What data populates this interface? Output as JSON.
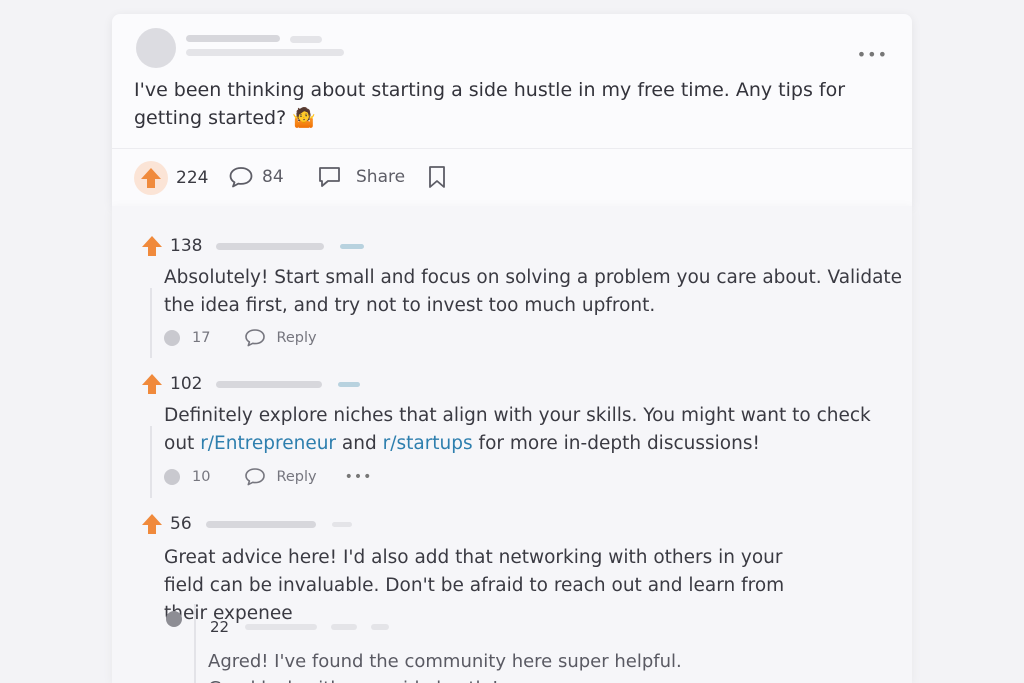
{
  "post": {
    "body": "I've been thinking about starting a side hustle in my free time. Any tips for getting started?",
    "emoji": "🤷",
    "upvotes": "224",
    "comments": "84",
    "share_label": "Share"
  },
  "comments": [
    {
      "score": "138",
      "text": "Absolutely! Start small and focus on solving a problem you care about. Validate the idea first, and try not to invest too much upfront.",
      "reply_count": "17",
      "reply_label": "Reply"
    },
    {
      "score": "102",
      "text_before": "Definitely explore niches that align with your skills. You might want to check out ",
      "link1": "r/Entrepreneur",
      "text_mid": " and ",
      "link2": "r/startups",
      "text_after": " for more in-depth discussions!",
      "reply_count": "10",
      "reply_label": "Reply"
    },
    {
      "score": "56",
      "text": "Great advice here! I'd also add that networking with others in your field can be invaluable. Don't be afraid to reach out and learn from their expenee",
      "nested": {
        "score": "22",
        "text": "Agred! I've found the community here super helpful. Good luck with your side hustle!"
      }
    }
  ],
  "colors": {
    "upvote": "#f08a3c",
    "link": "#2e7fae"
  },
  "icons": [
    "upvote-arrow-icon",
    "comment-bubble-icon",
    "share-icon",
    "bookmark-icon",
    "more-icon",
    "reply-icon"
  ]
}
